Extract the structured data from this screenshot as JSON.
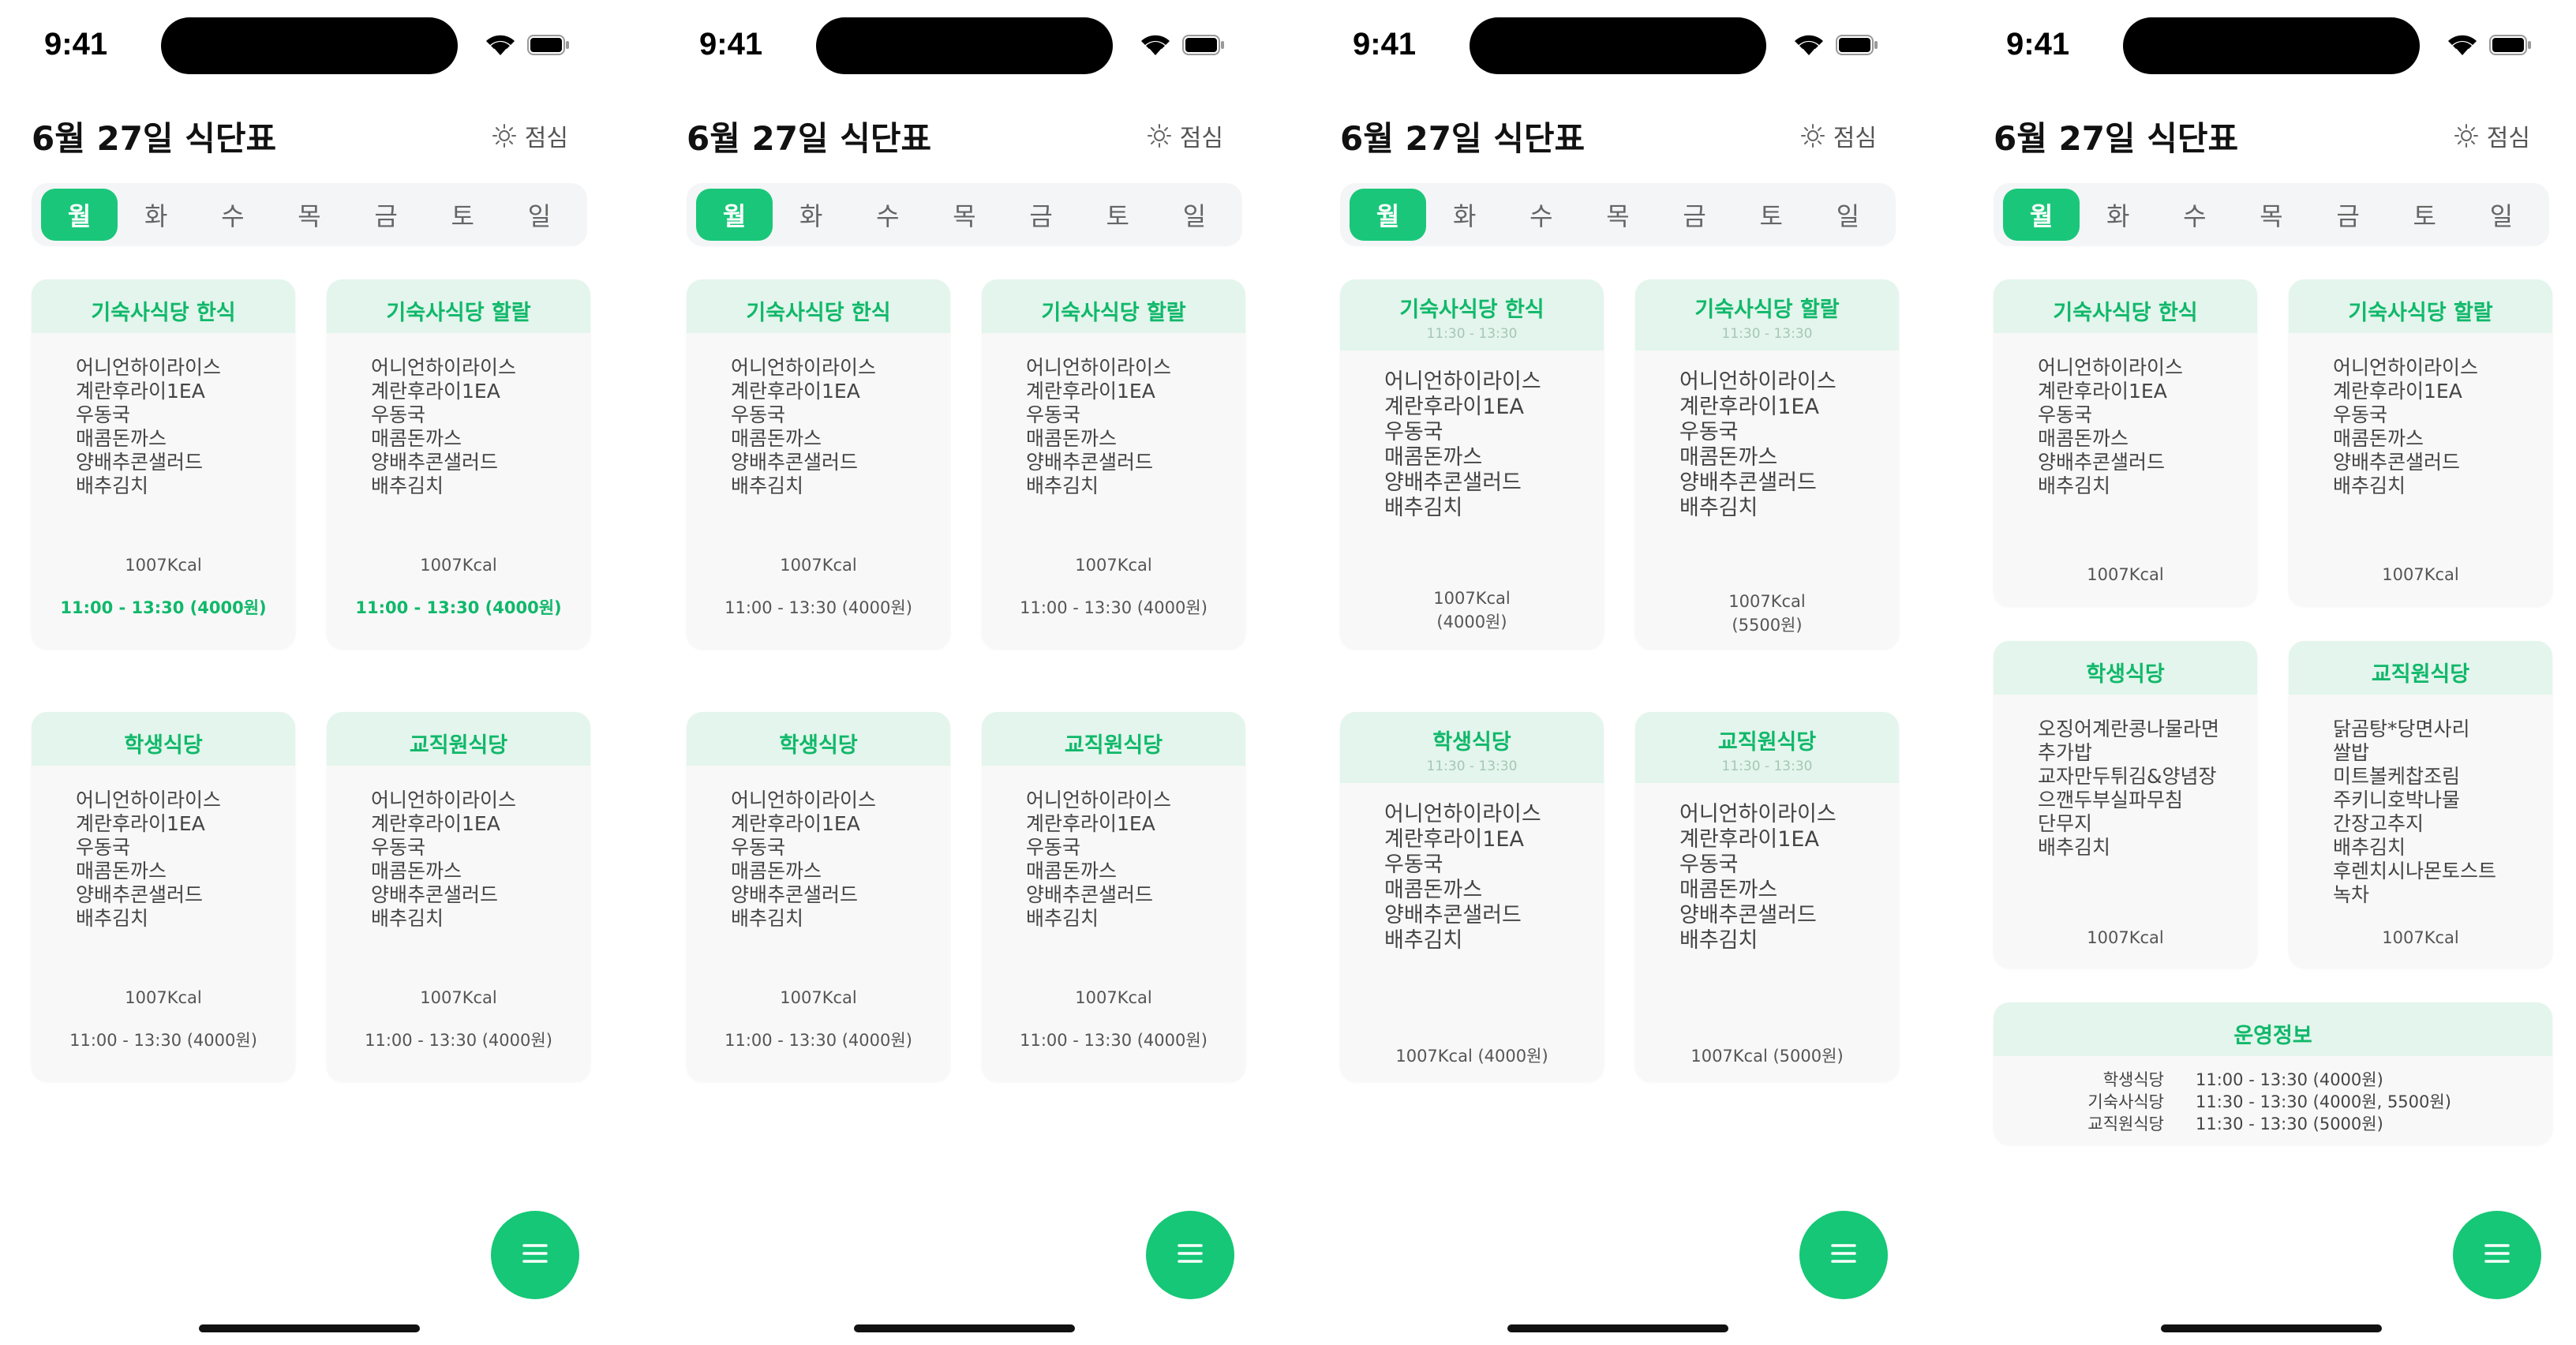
{
  "status_time": "9:41",
  "header": {
    "title": "6월 27일 식단표",
    "meal": "점심",
    "meal_icon": "sun-icon"
  },
  "days": [
    "월",
    "화",
    "수",
    "목",
    "금",
    "토",
    "일"
  ],
  "accent": "#1ac77a",
  "fab_icon": "menu-icon",
  "default_menu": [
    "어니언하이라이스",
    "계란후라이1EA",
    "우동국",
    "매콤돈까스",
    "양배추콘샐러드",
    "배추김치"
  ],
  "screens": [
    {
      "cards": {
        "dorm_korean": {
          "title": "기숙사식당 한식",
          "kcal": "1007Kcal",
          "price": "11:00 - 13:30 (4000원)"
        },
        "dorm_halal": {
          "title": "기숙사식당 할랄",
          "kcal": "1007Kcal",
          "price": "11:00 - 13:30 (4000원)"
        },
        "student": {
          "title": "학생식당",
          "kcal": "1007Kcal",
          "price": "11:00 - 13:30 (4000원)"
        },
        "faculty": {
          "title": "교직원식당",
          "kcal": "1007Kcal",
          "price": "11:00 - 13:30 (4000원)"
        }
      }
    },
    {
      "cards": {
        "dorm_korean": {
          "title": "기숙사식당 한식",
          "kcal": "1007Kcal",
          "price": "11:00 - 13:30 (4000원)"
        },
        "dorm_halal": {
          "title": "기숙사식당 할랄",
          "kcal": "1007Kcal",
          "price": "11:00 - 13:30 (4000원)"
        },
        "student": {
          "title": "학생식당",
          "kcal": "1007Kcal",
          "price": "11:00 - 13:30 (4000원)"
        },
        "faculty": {
          "title": "교직원식당",
          "kcal": "1007Kcal",
          "price": "11:00 - 13:30 (4000원)"
        }
      }
    },
    {
      "cards": {
        "dorm_korean": {
          "title": "기숙사식당 한식",
          "time": "11:30 - 13:30",
          "kcal": "1007Kcal",
          "price": "(4000원)"
        },
        "dorm_halal": {
          "title": "기숙사식당 할랄",
          "time": "11:30 - 13:30",
          "kcal": "1007Kcal",
          "price": "(5500원)"
        },
        "student": {
          "title": "학생식당",
          "time": "11:30 - 13:30",
          "kcal": "1007Kcal (4000원)"
        },
        "faculty": {
          "title": "교직원식당",
          "time": "11:30 - 13:30",
          "kcal": "1007Kcal (5000원)"
        }
      }
    },
    {
      "cards": {
        "dorm_korean": {
          "title": "기숙사식당 한식",
          "kcal": "1007Kcal"
        },
        "dorm_halal": {
          "title": "기숙사식당 할랄",
          "kcal": "1007Kcal"
        },
        "student": {
          "title": "학생식당",
          "kcal": "1007Kcal",
          "menu": [
            "오징어계란콩나물라면",
            "추가밥",
            "교자만두튀김&양념장",
            "으깬두부실파무침",
            "단무지",
            "배추김치"
          ]
        },
        "faculty": {
          "title": "교직원식당",
          "kcal": "1007Kcal",
          "menu": [
            "닭곰탕*당면사리",
            "쌀밥",
            "미트볼케찹조림",
            "주키니호박나물",
            "간장고추지",
            "배추김치",
            "후렌치시나몬토스트",
            "녹차"
          ]
        }
      },
      "info": {
        "title": "운영정보",
        "rows": [
          {
            "name": "학생식당",
            "time": "11:00 - 13:30 (4000원)"
          },
          {
            "name": "기숙사식당",
            "time": "11:30 - 13:30 (4000원, 5500원)"
          },
          {
            "name": "교직원식당",
            "time": "11:30 - 13:30 (5000원)"
          }
        ]
      }
    }
  ]
}
